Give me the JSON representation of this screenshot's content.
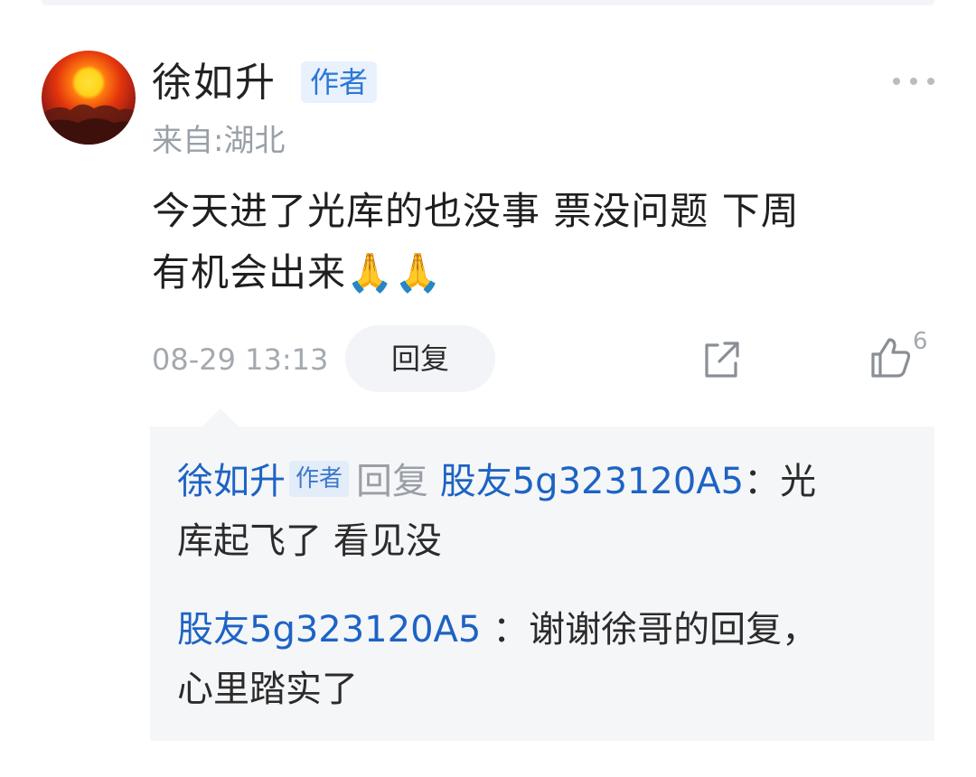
{
  "comment": {
    "author": {
      "name": "徐如升",
      "badge": "作者",
      "avatar_icon": "sunset-avatar",
      "location": "来自:湖北"
    },
    "text_line1": "今天进了光库的也没事 票没问题 下周",
    "text_line2": "有机会出来🙏🙏",
    "timestamp": "08-29 13:13",
    "reply_label": "回复",
    "share_icon": "share-icon",
    "like_icon": "thumbs-up-icon",
    "like_count": "6",
    "more_icon": "more-icon"
  },
  "replies": [
    {
      "author": "徐如升",
      "badge": "作者",
      "verb": "回复",
      "target": "股友5g323120A5",
      "separator": "：",
      "text_part1": "光",
      "text_part2": "库起飞了  看见没"
    },
    {
      "author": "股友5g323120A5",
      "separator": " ：",
      "text_part1": "谢谢徐哥的回复，",
      "text_part2": "心里踏实了"
    }
  ],
  "colors": {
    "link_blue": "#1d63c4",
    "badge_blue": "#2a78d6",
    "meta_grey": "#a4a9b0",
    "reply_bg": "#f5f6f8"
  }
}
